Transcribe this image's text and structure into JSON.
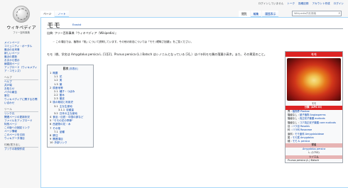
{
  "logo": {
    "name": "ウィキペディア",
    "tagline": "フリー百科事典"
  },
  "personal": [
    "ログインしていません",
    "トーク",
    "投稿記録",
    "アカウント作成",
    "ログイン"
  ],
  "tabs_left": [
    "ページ",
    "ノート"
  ],
  "tabs_right": [
    "閲覧",
    "編集",
    "履歴表示"
  ],
  "search": {
    "placeholder": "Wikipedia内を検索"
  },
  "sidebar": {
    "main": [
      "メインページ",
      "コミュニティ・ポータル",
      "最近の出来事",
      "新しいページ",
      "最近の更新",
      "おまかせ表示",
      "練習用ページ",
      "アップロード（ウィキメディア・コモンズ）"
    ],
    "help_heading": "ヘルプ",
    "help": [
      "ヘルプ",
      "井戸端",
      "お知らせ",
      "バグの報告",
      "寄付",
      "ウィキペディアに関するお問い合わせ"
    ],
    "tools_heading": "ツール",
    "tools": [
      "リンク元",
      "関連ページの更新状況",
      "ファイルをアップロード",
      "特別ページ",
      "この版への固定リンク",
      "ページ情報",
      "このページを引用",
      "ウィキデータ項目"
    ],
    "print_heading": "印刷/書き出し",
    "print": [
      "ブックの新規作成"
    ]
  },
  "article": {
    "title": "モモ",
    "lang_link": "Ecosist",
    "from": "出典: フリー百科事典『ウィキペディア（Wikipedia）』",
    "hatnote": "この項目では、植物の「桃」について説明しています。その他の用法については「モモ (曖昧さ回避)」をご覧ください。",
    "lead": "モモ（桃、学名は Amygdalus persica L. [1][2]、Prunus persica (L.) Batsch はシノニムとなっている [3]。）はバラ科モモ属の落葉小高木。また、その果実のこと。"
  },
  "toc": {
    "title": "目次",
    "toggle": "[非表示]",
    "entries": [
      {
        "n": "1",
        "t": "概要",
        "lvl": 1
      },
      {
        "n": "1.1",
        "t": "花",
        "lvl": 2
      },
      {
        "n": "1.2",
        "t": "実",
        "lvl": 2
      },
      {
        "n": "1.3",
        "t": "葉",
        "lvl": 2
      },
      {
        "n": "2",
        "t": "原産地等",
        "lvl": 1
      },
      {
        "n": "2.1",
        "t": "種子・つぼみ",
        "lvl": 2
      },
      {
        "n": "2.2",
        "t": "樹木",
        "lvl": 2
      },
      {
        "n": "2.3",
        "t": "樹皮",
        "lvl": 2
      },
      {
        "n": "3",
        "t": "桃の栽培と利用史",
        "lvl": 1
      },
      {
        "n": "3.1",
        "t": "主な生産地",
        "lvl": 2
      },
      {
        "n": "3.1.1",
        "t": "収穫量",
        "lvl": 3
      },
      {
        "n": "3.2",
        "t": "日本の主な産地",
        "lvl": 2
      },
      {
        "n": "4",
        "t": "食品・伝説・中国の諺など",
        "lvl": 1
      },
      {
        "n": "5",
        "t": "\"モモの花の季節\"",
        "lvl": 1
      },
      {
        "n": "6",
        "t": "西遊物の花・木",
        "lvl": 1
      },
      {
        "n": "7",
        "t": "その他",
        "lvl": 1
      },
      {
        "n": "7.1",
        "t": "品種",
        "lvl": 2
      },
      {
        "n": "8",
        "t": "脚注",
        "lvl": 1
      },
      {
        "n": "9",
        "t": "関連項目",
        "lvl": 1
      },
      {
        "n": "10",
        "t": "外部リンク",
        "lvl": 1
      }
    ]
  },
  "infobox": {
    "title": "モモ",
    "caption": "モモ",
    "class_heading": "分類（APG III）",
    "rows": [
      {
        "k": "界",
        "v": "植物界 Plantae"
      },
      {
        "k": "階級なし",
        "v": "被子植物 Angiosperms"
      },
      {
        "k": "階級なし",
        "v": "真正双子葉類 eudicots"
      },
      {
        "k": "階級なし",
        "v": "コア真正双子葉類 core eudicots"
      },
      {
        "k": "目",
        "v": "バラ目 Rosales"
      },
      {
        "k": "科",
        "v": "バラ科 Rosaceae"
      },
      {
        "k": "亜科",
        "v": "モモ亜科 Amygdaloideae"
      },
      {
        "k": "属",
        "v": "モモ属 Amygdalus"
      },
      {
        "k": "種",
        "v": "モモ A. persica"
      }
    ],
    "sci_heading": "学名",
    "sci": "Amygdalus persica",
    "sci_author": "L. (1753)",
    "syn_heading": "シノニム",
    "syn": "Prunus persica (L.) Batsch"
  }
}
